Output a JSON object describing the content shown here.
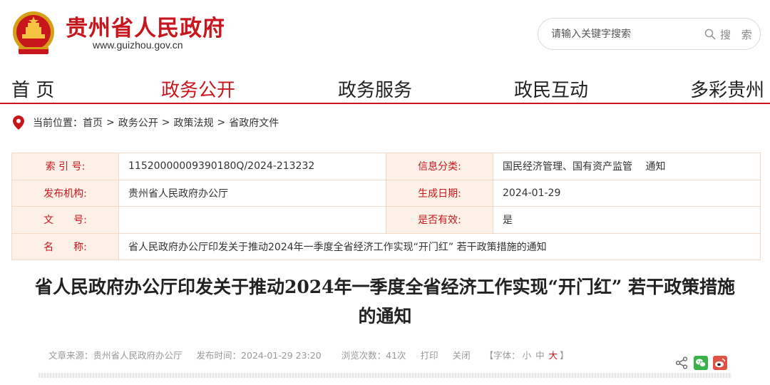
{
  "header": {
    "site_title": "贵州省人民政府",
    "site_url": "www.guizhou.gov.cn",
    "search_placeholder": "请输入关键字搜索",
    "search_label": "搜 索"
  },
  "nav": {
    "items": [
      "首 页",
      "政务公开",
      "政务服务",
      "政民互动",
      "多彩贵州"
    ],
    "active": "政务公开"
  },
  "breadcrumb": {
    "prefix": "当前位置：",
    "items": [
      "首页",
      "政务公开",
      "政策法规",
      "省政府文件"
    ],
    "separator": ">"
  },
  "meta": {
    "index_label": "索 引 号:",
    "index_value": "11520000009390180Q/2024-213232",
    "category_label": "信息分类:",
    "category_value": "国民经济管理、国有资产监管　 通知",
    "publisher_label": "发布机构:",
    "publisher_value": "贵州省人民政府办公厅",
    "date_label": "生成日期:",
    "date_value": "2024-01-29",
    "docno_label": "文　　号:",
    "docno_value": "",
    "valid_label": "是否有效:",
    "valid_value": "是",
    "name_label": "名　　称:",
    "name_value": "省人民政府办公厅印发关于推动2024年一季度全省经济工作实现“开门红” 若干政策措施的通知"
  },
  "article": {
    "title": "省人民政府办公厅印发关于推动2024年一季度全省经济工作实现“开门红” 若干政策措施的通知",
    "source": "文章来源：贵州省人民政府办公厅",
    "publish_time": "发布时间：2024-01-29 23:20",
    "views": "浏览次数：41次",
    "print_label": "打印",
    "close_label": "关闭",
    "font_prefix": "【字体：",
    "font_small": "小",
    "font_medium": "中",
    "font_large": "大",
    "font_suffix": "】"
  },
  "colors": {
    "brand_red": "#c8161d",
    "label_bg": "#fdf1e7",
    "wechat_green": "#3bb14a",
    "weibo_red": "#e05244"
  },
  "icons": [
    "national-emblem-icon",
    "search-icon",
    "location-pin-icon",
    "share-icon",
    "wechat-icon",
    "weibo-icon"
  ]
}
